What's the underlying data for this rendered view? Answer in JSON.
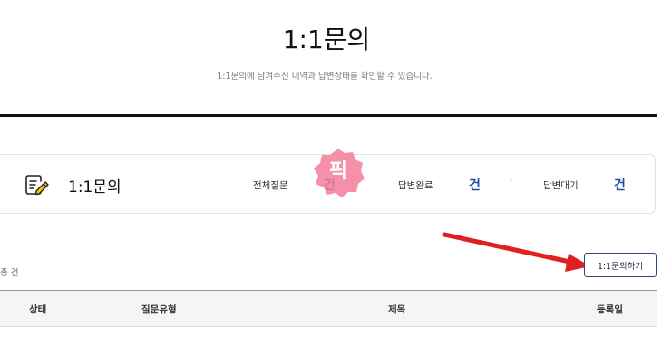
{
  "header": {
    "title": "1:1문의",
    "subtitle": "1:1문의에 남겨주신 내역과 답변상태를 확인할 수 있습니다."
  },
  "summary": {
    "title": "1:1문의",
    "icon": "notepad-pencil-icon",
    "stats": [
      {
        "label": "전체질문",
        "value": "건"
      },
      {
        "label": "답변완료",
        "value": "건"
      },
      {
        "label": "답변대기",
        "value": "건"
      }
    ],
    "separator": "·",
    "badge_text": "픽"
  },
  "list": {
    "count_text": "총 건"
  },
  "actions": {
    "inquire_button_label": "1:1문의하기"
  },
  "table": {
    "columns": [
      "상태",
      "질문유형",
      "제목",
      "등록일"
    ]
  },
  "colors": {
    "stat_value": "#1e4fa0",
    "badge": "#f47c9b",
    "arrow": "#e02020",
    "button_border": "#2b4a7a"
  }
}
